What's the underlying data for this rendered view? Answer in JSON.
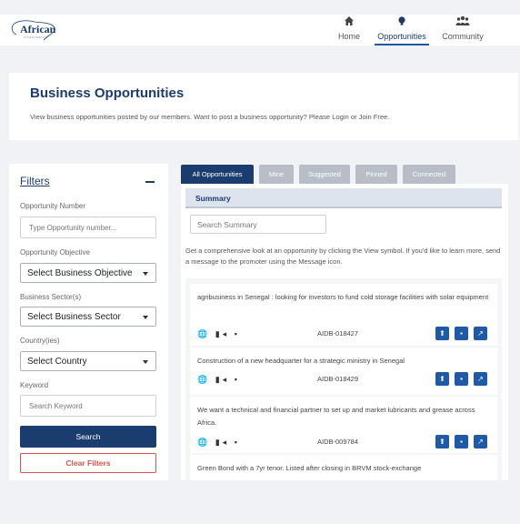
{
  "header": {
    "logo_text": "African",
    "logo_sub": "INVESTMENTS",
    "nav": [
      {
        "label": "Home",
        "icon": "home-icon"
      },
      {
        "label": "Opportunities",
        "icon": "lightbulb-icon"
      },
      {
        "label": "Community",
        "icon": "users-icon"
      }
    ]
  },
  "intro": {
    "title": "Business Opportunities",
    "text": "View business opportunities posted by our members. Want to post a business opportunity? Please Login or Join Free."
  },
  "filters": {
    "title": "Filters",
    "opportunity_number_label": "Opportunity Number",
    "opportunity_number_placeholder": "Type Opportunity number...",
    "objective_label": "Opportunity Objective",
    "objective_value": "Select Business Objective",
    "sector_label": "Business Sector(s)",
    "sector_value": "Select Business Sector",
    "country_label": "Country(ies)",
    "country_value": "Select Country",
    "keyword_label": "Keyword",
    "keyword_placeholder": "Search Keyword",
    "search_button": "Search",
    "clear_button": "Clear Filters"
  },
  "tabs": [
    "All Opportunities",
    "Mine",
    "Suggested",
    "Pinned",
    "Connected"
  ],
  "summary": {
    "heading": "Summary",
    "search_placeholder": "Search Summary",
    "description": "Get a comprehensive look at an opportunity by clicking the View symbol. If you'd like to learn more, send a message to the promoter using the Message icon."
  },
  "opportunities": [
    {
      "title": "agribusiness in Senegal : looking for investors to fund cold storage facilities with solar equipment",
      "id": "AIDB-018427"
    },
    {
      "title": "Construction of a new headquarter for a strategic ministry in Senegal",
      "id": "AIDB-018429"
    },
    {
      "title": "We want a technical and financial partner to set up and market lubricants and grease across Africa.",
      "id": "AIDB-009784"
    },
    {
      "title": "Green Bond with a 7yr tenor. Listed after closing in BRVM stock-exchange",
      "id": ""
    }
  ],
  "colors": {
    "primary": "#1b3c6e",
    "accent": "#1e5aa8",
    "danger": "#d9534f",
    "tab_inactive": "#b8bec8"
  }
}
